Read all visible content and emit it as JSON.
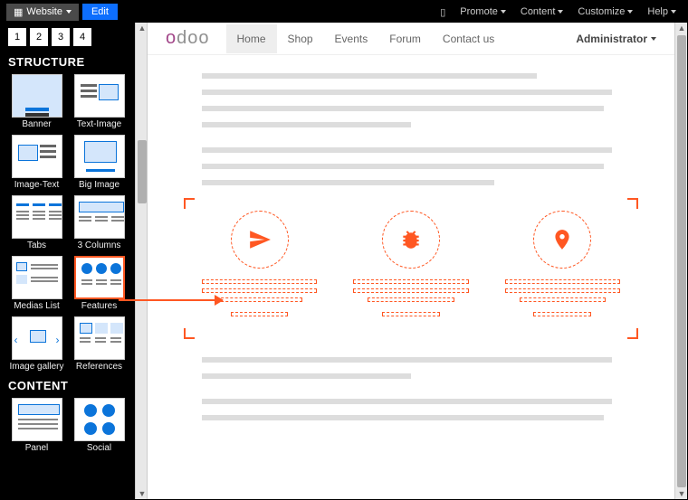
{
  "topbar": {
    "website_label": "Website",
    "edit_label": "Edit",
    "menu": [
      "Promote",
      "Content",
      "Customize",
      "Help"
    ]
  },
  "sidebar": {
    "pages": [
      "1",
      "2",
      "3",
      "4"
    ],
    "sections": {
      "structure_title": "STRUCTURE",
      "content_title": "CONTENT"
    },
    "blocks": {
      "banner": "Banner",
      "text_image": "Text-Image",
      "image_text": "Image-Text",
      "big_image": "Big Image",
      "tabs": "Tabs",
      "three_columns": "3 Columns",
      "medias_list": "Medias List",
      "features": "Features",
      "image_gallery": "Image gallery",
      "references": "References",
      "panel": "Panel",
      "social": "Social"
    }
  },
  "site": {
    "logo_prefix": "o",
    "logo_rest": "doo",
    "nav": {
      "home": "Home",
      "shop": "Shop",
      "events": "Events",
      "forum": "Forum",
      "contact": "Contact us"
    },
    "admin_label": "Administrator"
  }
}
